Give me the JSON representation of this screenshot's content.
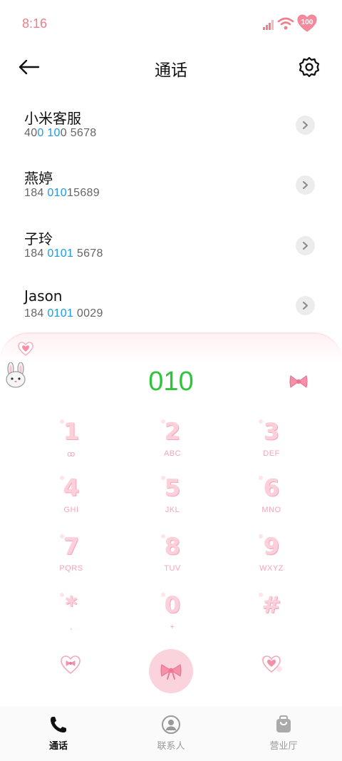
{
  "status_bar": {
    "time": "8:16",
    "battery": "100"
  },
  "header": {
    "title": "通话"
  },
  "contacts": [
    {
      "name": "小米客服",
      "number_parts": [
        "40",
        "0 10",
        "0 5678"
      ]
    },
    {
      "name": "燕婷",
      "number_parts": [
        "184 ",
        "010",
        "15689"
      ]
    },
    {
      "name": "子玲",
      "number_parts": [
        "184 ",
        "0101",
        " 5678"
      ]
    },
    {
      "name": "Jason",
      "number_parts": [
        "184 ",
        "0101",
        " 0029"
      ]
    }
  ],
  "dialpad": {
    "entered_number": "010",
    "keys": [
      {
        "digit": "1",
        "letters": "ꝏ"
      },
      {
        "digit": "2",
        "letters": "ABC"
      },
      {
        "digit": "3",
        "letters": "DEF"
      },
      {
        "digit": "4",
        "letters": "GHI"
      },
      {
        "digit": "5",
        "letters": "JKL"
      },
      {
        "digit": "6",
        "letters": "MNO"
      },
      {
        "digit": "7",
        "letters": "PQRS"
      },
      {
        "digit": "8",
        "letters": "TUV"
      },
      {
        "digit": "9",
        "letters": "WXYZ"
      },
      {
        "digit": "*",
        "letters": ","
      },
      {
        "digit": "0",
        "letters": "+"
      },
      {
        "digit": "#",
        "letters": ""
      }
    ]
  },
  "bottom_nav": {
    "items": [
      {
        "label": "通话",
        "icon": "phone-icon",
        "active": true
      },
      {
        "label": "联系人",
        "icon": "contact-person-icon",
        "active": false
      },
      {
        "label": "营业厅",
        "icon": "shopping-bag-icon",
        "active": false
      }
    ]
  },
  "colors": {
    "accent_pink": "#f27c8c",
    "number_highlight": "#1a9bf0",
    "dial_green": "#2fc43b",
    "call_button": "#fbd3dc"
  }
}
